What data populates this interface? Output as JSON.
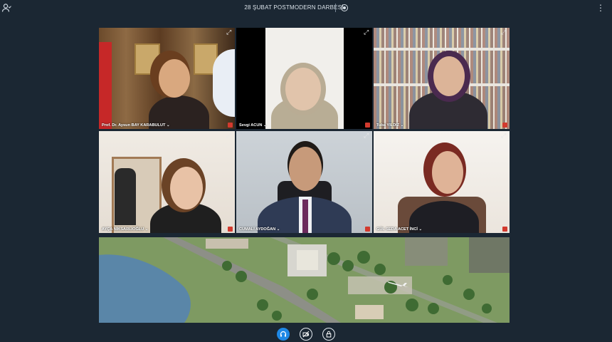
{
  "meeting": {
    "title": "28 ŞUBAT POSTMODERN DARBESİ"
  },
  "icons": {
    "user": "user-status-icon",
    "record": "record-icon",
    "more": "more-vertical-icon",
    "expand": "expand-icon",
    "mic_off": "mic-muted-icon",
    "audio": "headset-icon",
    "camera": "camera-off-icon",
    "lock": "lock-icon"
  },
  "participants": [
    {
      "name": "Prof. Dr. Aysun BAY KARABULUT"
    },
    {
      "name": "Sevgi ACUN"
    },
    {
      "name": "Tuba YILDIZ"
    },
    {
      "name": "AYÇA NİKSARLIOĞLU"
    },
    {
      "name": "CUMALİ AYDOĞAN"
    },
    {
      "name": "GÜL SEDA ACET İNCİ"
    }
  ],
  "colors": {
    "background": "#1b2733",
    "accent": "#1e88e5",
    "muted": "#d23a2e"
  }
}
